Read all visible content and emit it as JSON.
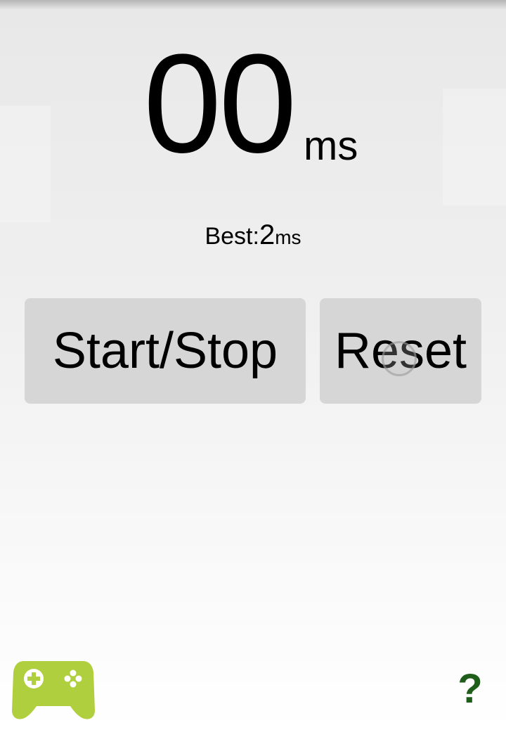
{
  "timer": {
    "value": "00",
    "unit": "ms"
  },
  "best": {
    "label": "Best:",
    "value": "2",
    "unit": "ms"
  },
  "buttons": {
    "start_stop": "Start/Stop",
    "reset": "Reset"
  },
  "icons": {
    "games": "game-controller-icon",
    "help": "?"
  },
  "colors": {
    "button_bg": "#d6d6d6",
    "games_icon": "#b0cf3e",
    "help_icon": "#1f5e1a"
  }
}
